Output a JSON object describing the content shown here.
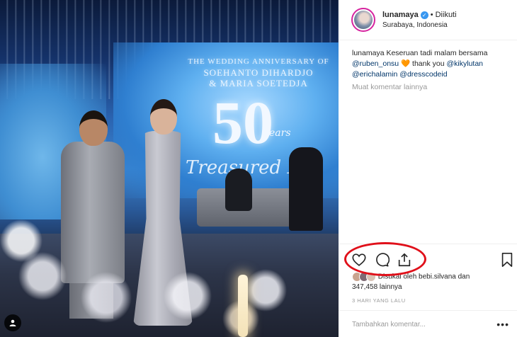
{
  "post": {
    "image": {
      "overlay_line1": "THE WEDDING ANNIVERSARY OF",
      "overlay_line2": "SOEHANTO DIHARDJO",
      "overlay_line3": "& MARIA SOETEDJA",
      "overlay_number": "50",
      "overlay_years": "Years",
      "overlay_script": "Treasured M"
    },
    "header": {
      "username": "lunamaya",
      "verified_icon": "verified-badge-icon",
      "separator": "•",
      "follow_status": "Diikuti",
      "location": "Surabaya, Indonesia"
    },
    "caption": {
      "username": "lunamaya",
      "text": "Keseruan tadi malam bersama",
      "mention1": "@ruben_onsu",
      "emoji": "🧡",
      "text2": "thank you",
      "mention2": "@kikylutan",
      "mention3": "@erichalamin",
      "mention4": "@dresscodeid"
    },
    "more_comments": "Muat komentar lainnya",
    "actions": {
      "like_icon": "heart-icon",
      "comment_icon": "comment-icon",
      "share_icon": "share-icon",
      "save_icon": "bookmark-icon",
      "highlight_color": "#e0101a"
    },
    "likes": {
      "line1": "Disukai oleh bebi.silvana dan",
      "line2": "347,458 lainnya"
    },
    "time_ago": "3 HARI YANG LALU",
    "comment": {
      "placeholder": "Tambahkan komentar...",
      "more_label": "•••"
    }
  }
}
